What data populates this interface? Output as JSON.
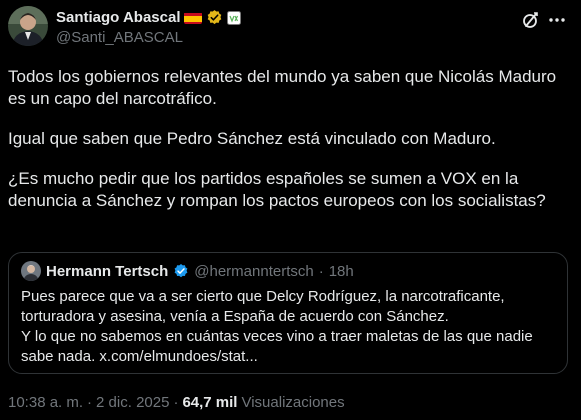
{
  "author": {
    "name": "Santiago Abascal",
    "handle": "@Santi_ABASCAL",
    "badges": [
      "spain-flag-icon",
      "verified-gold-icon",
      "vox-affiliate-icon"
    ],
    "verified_color": "#e2b719"
  },
  "tweet": {
    "paragraphs": [
      "Todos los gobiernos relevantes del mundo ya saben que Nicolás Maduro es un capo del narcotráfico.",
      "Igual que saben que  Pedro Sánchez está vinculado con Maduro.",
      "¿Es mucho pedir que los partidos españoles se sumen a VOX en la denuncia a Sánchez y rompan los pactos europeos con los socialistas?"
    ]
  },
  "quote": {
    "name": "Hermann Tertsch",
    "handle": "@hermanntertsch",
    "separator": "·",
    "time": "18h",
    "verified_color": "#1d9bf0",
    "lines": [
      "Pues parece que va a ser cierto que Delcy Rodríguez, la narcotraficante,",
      "torturadora y asesina, venía a España de acuerdo con Sánchez.",
      "Y lo que no sabemos en cuántas veces vino a traer maletas de las que nadie",
      "sabe nada. x.com/elmundoes/stat..."
    ]
  },
  "meta": {
    "time": "10:38 a. m.",
    "separator1": "·",
    "date": "2 dic. 2025",
    "separator2": "·",
    "views_count": "64,7 mil",
    "views_label": "Visualizaciones"
  },
  "colors": {
    "background": "#000000",
    "text": "#e7e9ea",
    "secondary": "#71767b",
    "border": "#2f3336"
  }
}
